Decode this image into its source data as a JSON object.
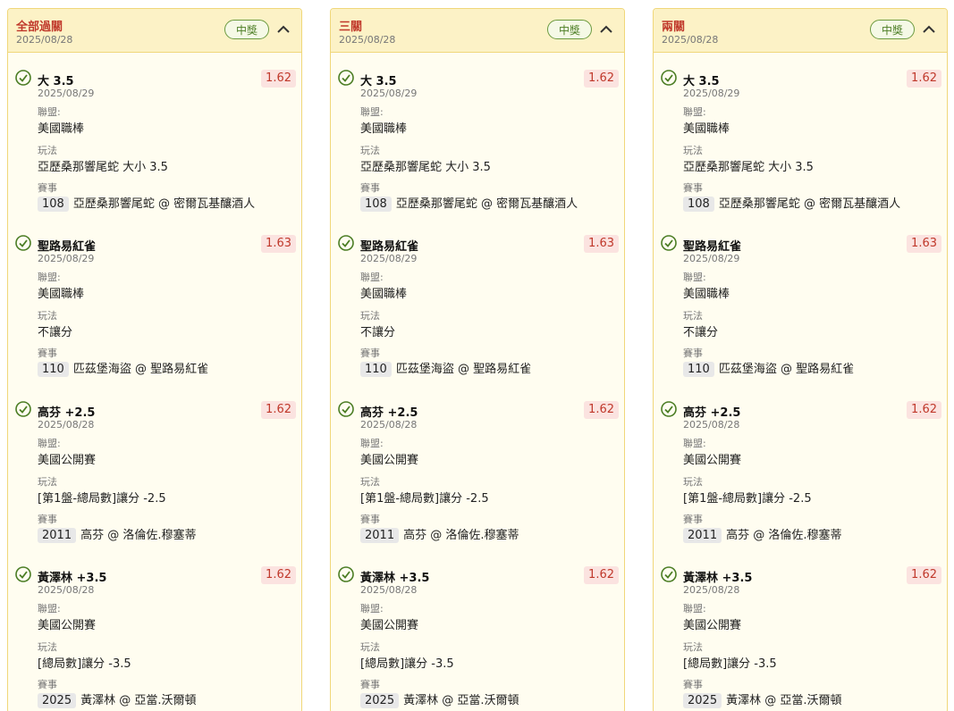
{
  "labels": {
    "league": "聯盟:",
    "market": "玩法",
    "event": "賽事"
  },
  "colors": {
    "accent_red": "#c0392b",
    "win_green": "#4b7d24",
    "header_yellow": "#fcf2c6"
  },
  "cards": [
    {
      "title": "全部過關",
      "date": "2025/08/28",
      "badge": "中獎",
      "legs": [
        {
          "title": "大 3.5",
          "date": "2025/08/29",
          "odds": "1.62",
          "league": "美國職棒",
          "market": "亞歷桑那響尾蛇 大小 3.5",
          "event_no": "108",
          "event": "亞歷桑那響尾蛇 @ 密爾瓦基釀酒人"
        },
        {
          "title": "聖路易紅雀",
          "date": "2025/08/29",
          "odds": "1.63",
          "league": "美國職棒",
          "market": "不讓分",
          "event_no": "110",
          "event": "匹茲堡海盜 @ 聖路易紅雀"
        },
        {
          "title": "高芬 +2.5",
          "date": "2025/08/28",
          "odds": "1.62",
          "league": "美國公開賽",
          "market": "[第1盤-總局數]讓分 -2.5",
          "event_no": "2011",
          "event": "高芬 @ 洛倫佐.穆塞蒂"
        },
        {
          "title": "黃澤林 +3.5",
          "date": "2025/08/28",
          "odds": "1.62",
          "league": "美國公開賽",
          "market": "[總局數]讓分 -3.5",
          "event_no": "2025",
          "event": "黃澤林 @ 亞當.沃爾頓"
        }
      ]
    },
    {
      "title": "三關",
      "date": "2025/08/28",
      "badge": "中獎",
      "legs": [
        {
          "title": "大 3.5",
          "date": "2025/08/29",
          "odds": "1.62",
          "league": "美國職棒",
          "market": "亞歷桑那響尾蛇 大小 3.5",
          "event_no": "108",
          "event": "亞歷桑那響尾蛇 @ 密爾瓦基釀酒人"
        },
        {
          "title": "聖路易紅雀",
          "date": "2025/08/29",
          "odds": "1.63",
          "league": "美國職棒",
          "market": "不讓分",
          "event_no": "110",
          "event": "匹茲堡海盜 @ 聖路易紅雀"
        },
        {
          "title": "高芬 +2.5",
          "date": "2025/08/28",
          "odds": "1.62",
          "league": "美國公開賽",
          "market": "[第1盤-總局數]讓分 -2.5",
          "event_no": "2011",
          "event": "高芬 @ 洛倫佐.穆塞蒂"
        },
        {
          "title": "黃澤林 +3.5",
          "date": "2025/08/28",
          "odds": "1.62",
          "league": "美國公開賽",
          "market": "[總局數]讓分 -3.5",
          "event_no": "2025",
          "event": "黃澤林 @ 亞當.沃爾頓"
        }
      ]
    },
    {
      "title": "兩關",
      "date": "2025/08/28",
      "badge": "中獎",
      "legs": [
        {
          "title": "大 3.5",
          "date": "2025/08/29",
          "odds": "1.62",
          "league": "美國職棒",
          "market": "亞歷桑那響尾蛇 大小 3.5",
          "event_no": "108",
          "event": "亞歷桑那響尾蛇 @ 密爾瓦基釀酒人"
        },
        {
          "title": "聖路易紅雀",
          "date": "2025/08/29",
          "odds": "1.63",
          "league": "美國職棒",
          "market": "不讓分",
          "event_no": "110",
          "event": "匹茲堡海盜 @ 聖路易紅雀"
        },
        {
          "title": "高芬 +2.5",
          "date": "2025/08/28",
          "odds": "1.62",
          "league": "美國公開賽",
          "market": "[第1盤-總局數]讓分 -2.5",
          "event_no": "2011",
          "event": "高芬 @ 洛倫佐.穆塞蒂"
        },
        {
          "title": "黃澤林 +3.5",
          "date": "2025/08/28",
          "odds": "1.62",
          "league": "美國公開賽",
          "market": "[總局數]讓分 -3.5",
          "event_no": "2025",
          "event": "黃澤林 @ 亞當.沃爾頓"
        }
      ]
    }
  ]
}
